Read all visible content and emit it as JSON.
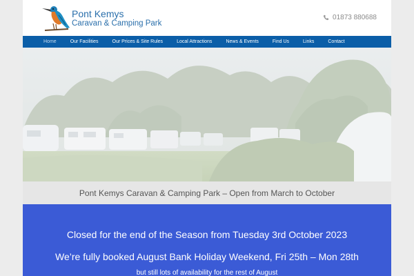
{
  "header": {
    "title": "Pont Kemys",
    "subtitle": "Caravan & Camping Park",
    "phone": "01873 880688"
  },
  "nav": {
    "items": [
      {
        "label": "Home"
      },
      {
        "label": "Our Facilities"
      },
      {
        "label": "Our Prices & Site Rules"
      },
      {
        "label": "Local Attractions"
      },
      {
        "label": "News & Events"
      },
      {
        "label": "Find Us"
      },
      {
        "label": "Links"
      },
      {
        "label": "Contact"
      }
    ]
  },
  "tagline": "Pont Kemys Caravan & Camping Park – Open from March to October",
  "notice": {
    "line1": "Closed for the end of the Season from Tuesday 3rd October 2023",
    "line2": "We’re fully booked August Bank Holiday Weekend, Fri 25th – Mon 28th",
    "line3": "but still lots of availability for the rest of August"
  },
  "colors": {
    "nav_bg": "#0b5ea8",
    "brand_text": "#2a6fab",
    "notice_bg": "#3b5bd6",
    "tagline_bg": "#e6e6e6"
  },
  "icons": {
    "logo": "kingfisher-bird-icon",
    "phone": "phone-icon"
  }
}
